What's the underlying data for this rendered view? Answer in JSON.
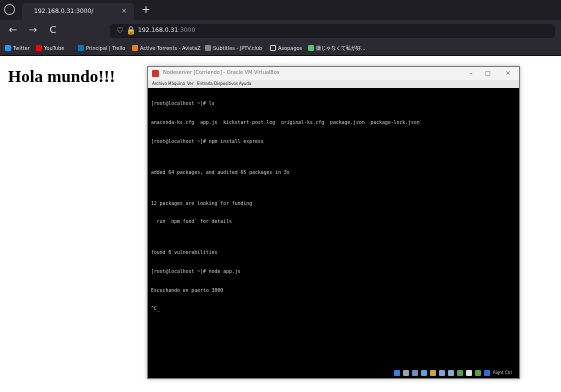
{
  "browser": {
    "tab": {
      "title": "192.168.0.31:3000/",
      "close": "×"
    },
    "new_tab": "+",
    "nav": {
      "back": "←",
      "forward": "→",
      "reload": "C"
    },
    "url": {
      "host": "192.168.0.31",
      "port": ":3000",
      "shield": "♡",
      "lock": "🔒"
    },
    "bookmarks": [
      {
        "label": "Twitter",
        "color": "#1d9bf0"
      },
      {
        "label": "YouTube",
        "color": "#ff0000"
      },
      {
        "label": "Principal | Trello",
        "color": "#0079bf"
      },
      {
        "label": "Active Torrents - AvistaZ",
        "color": "#f07a1a"
      },
      {
        "label": "Subtitles - JPTV.club",
        "color": "#888888"
      },
      {
        "label": "Asopagos",
        "color": "#cfcfcf"
      },
      {
        "label": "嫌じゃなくて私が好...",
        "color": "#56c26b"
      }
    ]
  },
  "page": {
    "heading": "Hola mundo!!!"
  },
  "vbox": {
    "title": "Nodeserver [Corriendo] - Oracle VM VirtualBox",
    "controls": {
      "minimize": "–",
      "maximize": "□",
      "close": "×"
    },
    "menu": [
      "Archivo",
      "Máquina",
      "Ver",
      "Entrada",
      "Dispositivos",
      "Ayuda"
    ],
    "terminal": [
      "[root@localhost ~]# ls",
      "anaconda-ks.cfg  app.js  kickstart-post.log  original-ks.cfg  package.json  package-lock.json",
      "[root@localhost ~]# npm install express",
      "",
      "added 64 packages, and audited 65 packages in 3s",
      "",
      "12 packages are looking for funding",
      "  run `npm fund` for details",
      "",
      "found 0 vulnerabilities",
      "[root@localhost ~]# node app.js",
      "Escuchando en puerto 3000",
      "^C_"
    ],
    "status_label": "Right Ctrl"
  }
}
